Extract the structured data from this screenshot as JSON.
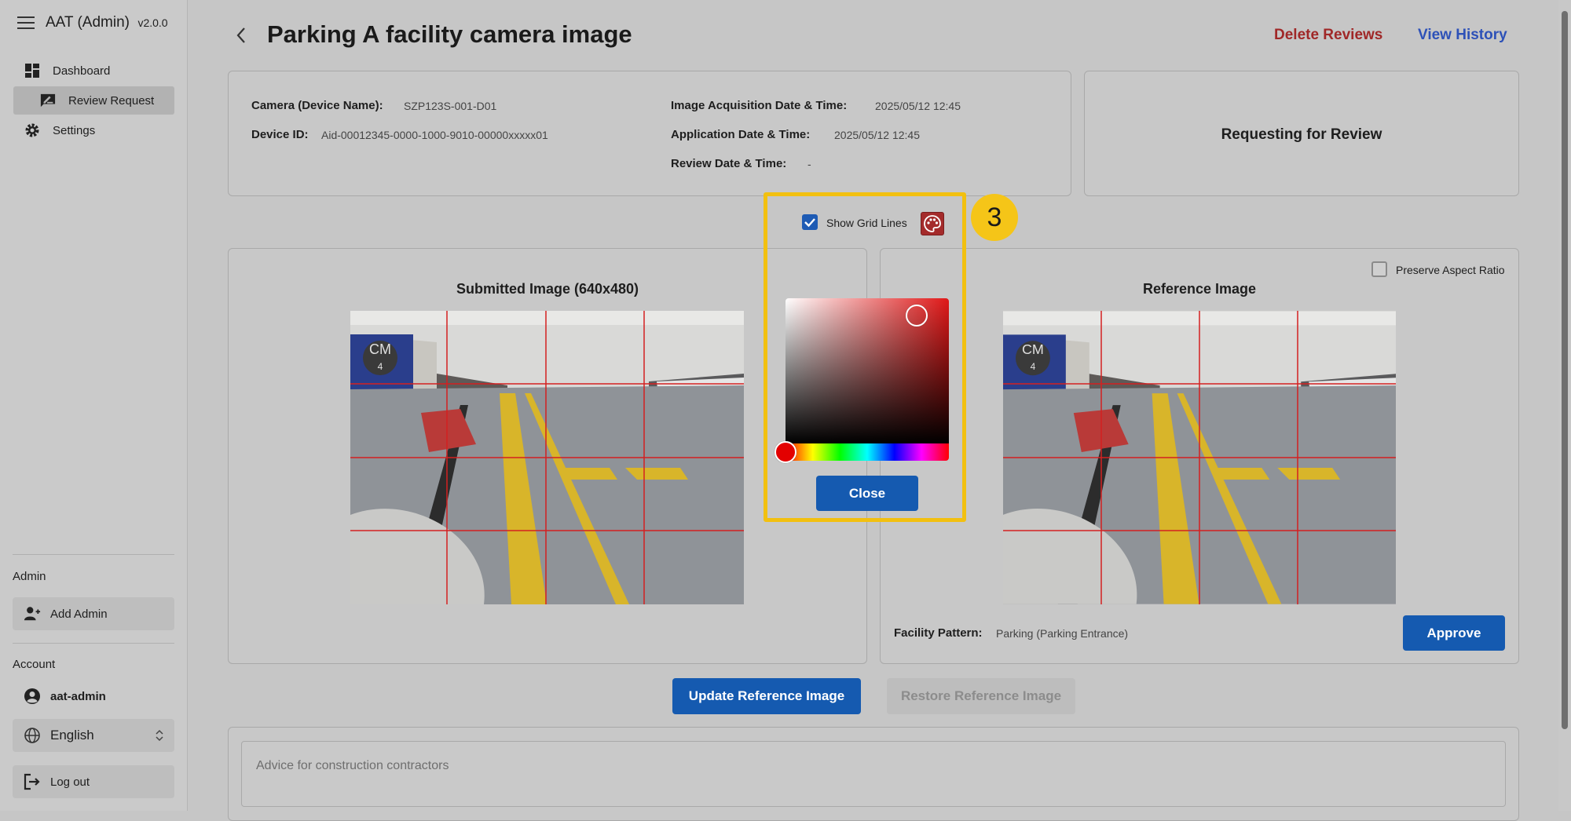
{
  "sidebar": {
    "app_title": "AAT (Admin)",
    "version": "v2.0.0",
    "nav": [
      {
        "label": "Dashboard",
        "icon": "dashboard-icon"
      },
      {
        "label": "Review Request",
        "icon": "rate-review-icon",
        "active": true
      },
      {
        "label": "Settings",
        "icon": "gear-icon"
      }
    ],
    "admin_section": "Admin",
    "add_admin": "Add Admin",
    "account_section": "Account",
    "username": "aat-admin",
    "language": "English",
    "logout": "Log out"
  },
  "header": {
    "title": "Parking A facility camera image",
    "delete_reviews": "Delete Reviews",
    "view_history": "View History"
  },
  "info": {
    "camera_label": "Camera (Device Name):",
    "camera_value": "SZP123S-001-D01",
    "device_id_label": "Device ID:",
    "device_id_value": "Aid-00012345-0000-1000-9010-00000xxxxx01",
    "acquisition_label": "Image Acquisition Date & Time:",
    "acquisition_value": "2025/05/12 12:45",
    "application_label": "Application Date & Time:",
    "application_value": "2025/05/12 12:45",
    "review_label": "Review Date & Time:",
    "review_value": "-"
  },
  "status": {
    "text": "Requesting for Review"
  },
  "grid_control": {
    "show_grid_lines": "Show Grid Lines",
    "checked": true,
    "grid_color": "#d42020"
  },
  "color_picker": {
    "close_label": "Close",
    "step_badge": "3",
    "highlight_color": "#f2c010"
  },
  "submitted": {
    "title": "Submitted Image (640x480)"
  },
  "reference": {
    "preserve_aspect_ratio": "Preserve Aspect Ratio",
    "title": "Reference Image",
    "facility_pattern_label": "Facility Pattern:",
    "facility_pattern_value": "Parking (Parking Entrance)",
    "approve": "Approve"
  },
  "photo_overlay": {
    "sign_text": "CM",
    "sign_number": "4"
  },
  "actions": {
    "update_reference": "Update Reference Image",
    "restore_reference": "Restore Reference Image"
  },
  "advice": {
    "placeholder": "Advice for construction contractors"
  },
  "colors": {
    "primary": "#155ab0",
    "danger": "#a02828",
    "link": "#2d51b8"
  }
}
